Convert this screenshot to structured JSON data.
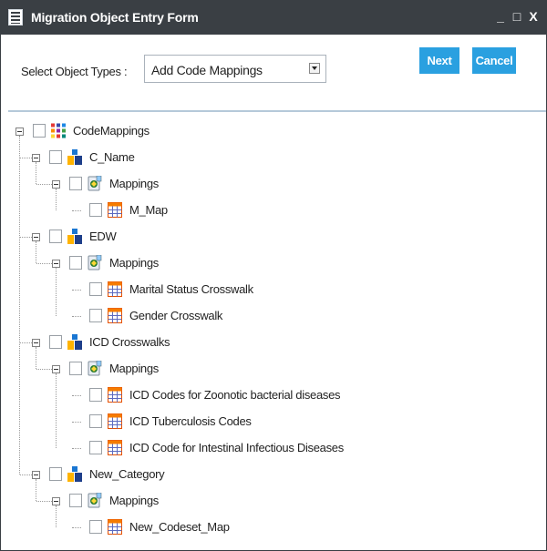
{
  "window": {
    "title": "Migration Object Entry Form",
    "controls": {
      "minimize": "_",
      "maximize": "□",
      "close": "X"
    }
  },
  "form": {
    "select_label": "Select Object Types :",
    "select_value": "Add Code Mappings",
    "next_label": "Next",
    "cancel_label": "Cancel"
  },
  "tree": {
    "root": "CodeMappings",
    "categories": [
      {
        "label": "C_Name",
        "group": "Mappings",
        "items": [
          "M_Map"
        ]
      },
      {
        "label": "EDW",
        "group": "Mappings",
        "items": [
          "Marital Status Crosswalk",
          "Gender Crosswalk"
        ]
      },
      {
        "label": "ICD Crosswalks",
        "group": "Mappings",
        "items": [
          "ICD Codes for Zoonotic bacterial diseases",
          "ICD Tuberculosis Codes",
          "ICD Code for Intestinal Infectious Diseases"
        ]
      },
      {
        "label": "New_Category",
        "group": "Mappings",
        "items": [
          "New_Codeset_Map"
        ]
      }
    ]
  },
  "colors": {
    "titlebar": "#3a3f44",
    "button": "#2aa0e0",
    "divider": "#b5c9d9"
  },
  "icons": {
    "root": "colorful-grid-icon",
    "category": "category-blocks-icon",
    "group": "mappings-icon",
    "item": "table-grid-icon"
  }
}
